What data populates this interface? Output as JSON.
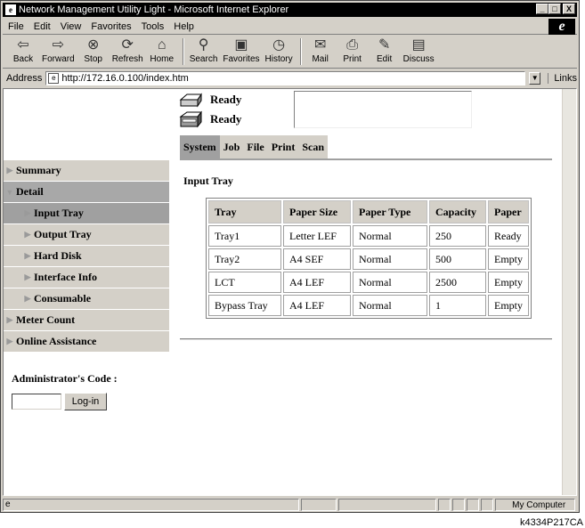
{
  "window": {
    "title": "Network Management Utility Light - Microsoft Internet Explorer",
    "min": "_",
    "max": "□",
    "close": "X"
  },
  "menu": [
    "File",
    "Edit",
    "View",
    "Favorites",
    "Tools",
    "Help"
  ],
  "toolbar": [
    {
      "label": "Back",
      "icon": "back-icon",
      "glyph": "⇦"
    },
    {
      "label": "Forward",
      "icon": "forward-icon",
      "glyph": "⇨"
    },
    {
      "label": "Stop",
      "icon": "stop-icon",
      "glyph": "⊗"
    },
    {
      "label": "Refresh",
      "icon": "refresh-icon",
      "glyph": "⟳"
    },
    {
      "label": "Home",
      "icon": "home-icon",
      "glyph": "⌂"
    },
    {
      "label": "Search",
      "icon": "search-icon",
      "glyph": "⚲"
    },
    {
      "label": "Favorites",
      "icon": "favorites-icon",
      "glyph": "▣"
    },
    {
      "label": "History",
      "icon": "history-icon",
      "glyph": "◷"
    },
    {
      "label": "Mail",
      "icon": "mail-icon",
      "glyph": "✉"
    },
    {
      "label": "Print",
      "icon": "print-icon",
      "glyph": "⎙"
    },
    {
      "label": "Edit",
      "icon": "edit-icon",
      "glyph": "✎"
    },
    {
      "label": "Discuss",
      "icon": "discuss-icon",
      "glyph": "▤"
    }
  ],
  "address": {
    "label": "Address",
    "url": "http://172.16.0.100/index.htm",
    "links": "Links"
  },
  "printer_status": [
    {
      "text": "Ready",
      "icon": "printer-icon"
    },
    {
      "text": "Ready",
      "icon": "scanner-icon"
    }
  ],
  "tabs": [
    "System",
    "Job",
    "File",
    "Print",
    "Scan"
  ],
  "active_tab": "System",
  "nav": [
    {
      "label": "Summary",
      "level": 0
    },
    {
      "label": "Detail",
      "level": 0,
      "expanded": true
    },
    {
      "label": "Input Tray",
      "level": 1,
      "active": true
    },
    {
      "label": "Output Tray",
      "level": 1
    },
    {
      "label": "Hard Disk",
      "level": 1
    },
    {
      "label": "Interface Info",
      "level": 1
    },
    {
      "label": "Consumable",
      "level": 1
    },
    {
      "label": "Meter Count",
      "level": 0
    },
    {
      "label": "Online Assistance",
      "level": 0
    }
  ],
  "admin": {
    "label": "Administrator's Code :",
    "login_button": "Log-in"
  },
  "section_title": "Input Tray",
  "tray_table": {
    "headers": [
      "Tray",
      "Paper Size",
      "Paper Type",
      "Capacity",
      "Paper"
    ],
    "rows": [
      [
        "Tray1",
        "Letter LEF",
        "Normal",
        "250",
        "Ready"
      ],
      [
        "Tray2",
        "A4 SEF",
        "Normal",
        "500",
        "Empty"
      ],
      [
        "LCT",
        "A4 LEF",
        "Normal",
        "2500",
        "Empty"
      ],
      [
        "Bypass Tray",
        "A4 LEF",
        "Normal",
        "1",
        "Empty"
      ]
    ]
  },
  "statusbar": {
    "zone": "My Computer"
  },
  "caption": "k4334P217CA"
}
